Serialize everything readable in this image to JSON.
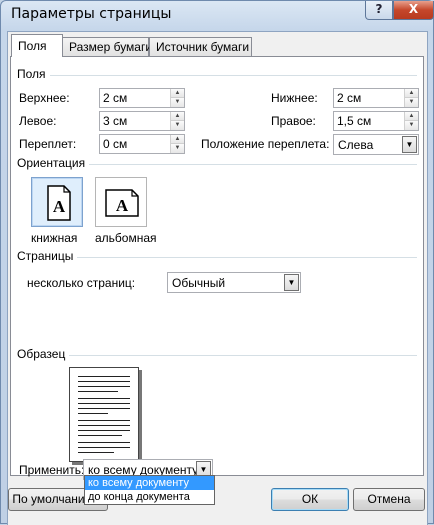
{
  "window": {
    "title": "Параметры страницы",
    "help_label": "?",
    "close_label": "X"
  },
  "tabs": [
    {
      "label": "Поля",
      "active": true
    },
    {
      "label": "Размер бумаги",
      "active": false
    },
    {
      "label": "Источник бумаги",
      "active": false
    }
  ],
  "margins": {
    "section_label": "Поля",
    "top_label": "Верхнее:",
    "top_value": "2 см",
    "bottom_label": "Нижнее:",
    "bottom_value": "2 см",
    "left_label": "Левое:",
    "left_value": "3 см",
    "right_label": "Правое:",
    "right_value": "1,5 см",
    "gutter_label": "Переплет:",
    "gutter_value": "0 см",
    "gutter_pos_label": "Положение переплета:",
    "gutter_pos_value": "Слева"
  },
  "orientation": {
    "section_label": "Ориентация",
    "portrait_label": "книжная",
    "landscape_label": "альбомная",
    "icon_letter": "A",
    "selected": "portrait"
  },
  "pages": {
    "section_label": "Страницы",
    "multiple_label": "несколько страниц:",
    "multiple_value": "Обычный"
  },
  "preview": {
    "section_label": "Образец"
  },
  "apply": {
    "label": "Применить:",
    "value": "ко всему документу",
    "options": [
      "ко всему документу",
      "до конца документа"
    ]
  },
  "buttons": {
    "default_label": "По умолчанию...",
    "ok_label": "ОК",
    "cancel_label": "Отмена"
  },
  "colors": {
    "selection": "#3399ff",
    "close_button": "#c5472b",
    "title_bar": "#c5d6ea"
  }
}
